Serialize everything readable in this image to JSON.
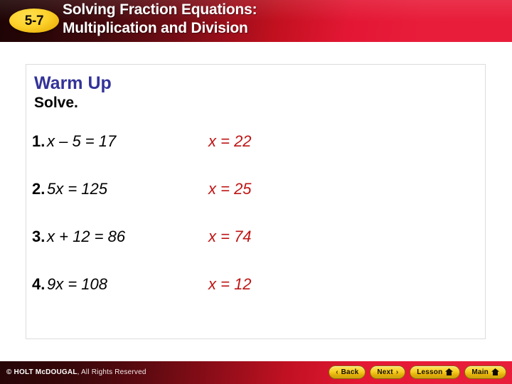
{
  "header": {
    "badge_label": "5-7",
    "title_line1": "Solving Fraction Equations:",
    "title_line2": "Multiplication and Division",
    "accent_dark": "#1d0405",
    "accent_red": "#e81d3a",
    "badge_color": "#fdd22c"
  },
  "card": {
    "warm_up_title": "Warm Up",
    "warm_up_color": "#333399",
    "solve_label": "Solve.",
    "answer_color": "#bf1515",
    "problems": [
      {
        "number": "1.",
        "equation": "x – 5 = 17",
        "answer": "x = 22"
      },
      {
        "number": "2.",
        "equation": "5x = 125",
        "answer": "x = 25"
      },
      {
        "number": "3.",
        "equation": "x + 12 = 86",
        "answer": "x = 74"
      },
      {
        "number": "4.",
        "equation": "9x = 108",
        "answer": "x = 12"
      }
    ]
  },
  "footer": {
    "copyright_brand": "© HOLT McDOUGAL",
    "copyright_rest": ", All Rights Reserved",
    "nav": [
      {
        "label": "Back",
        "icon": "chevron-left-icon",
        "glyph": "‹"
      },
      {
        "label": "Next",
        "icon": "chevron-right-icon",
        "glyph": "›"
      },
      {
        "label": "Lesson",
        "icon": "home-icon",
        "glyph": ""
      },
      {
        "label": "Main",
        "icon": "home-icon",
        "glyph": ""
      }
    ]
  }
}
